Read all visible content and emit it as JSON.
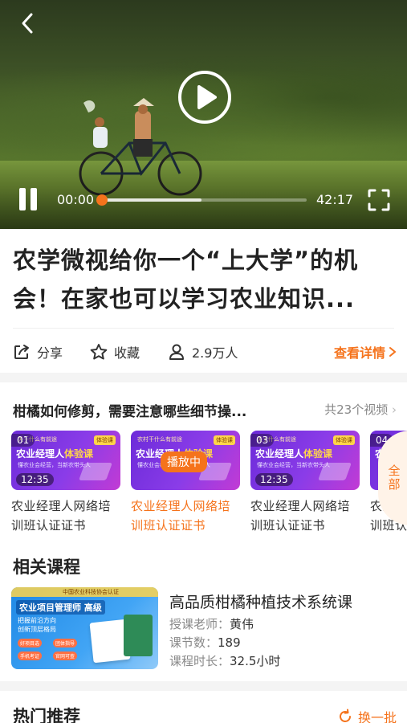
{
  "player": {
    "current_time": "00:00",
    "total_time": "42:17",
    "progress_fraction": 0.0,
    "buffered_fraction": 0.49
  },
  "video": {
    "title": "农学微视给你一个“上大学”的机会！在家也可以学习农业知识..."
  },
  "actions": {
    "share": "分享",
    "favorite": "收藏",
    "viewers": "2.9万人",
    "details": "查看详情"
  },
  "episodes": {
    "header_title": "柑橘如何修剪，需要注意哪些细节操...",
    "count": "共23个视频",
    "all_label": "全部",
    "playing_label": "播放中",
    "items": [
      {
        "num": "01",
        "duration": "12:35",
        "name": "农业经理人网络培训班认证证书",
        "active": false,
        "thumb_top": "关于什么有前途",
        "thumb_title_a": "农业经理人",
        "thumb_title_b": "体验课",
        "thumb_sub": "懂农业会经营，当新农带头人",
        "thumb_tag": "体验课"
      },
      {
        "num": "",
        "duration": "",
        "name": "农业经理人网络培训班认证证书",
        "active": true,
        "thumb_top": "农村干什么有前途",
        "thumb_title_a": "农业经理人",
        "thumb_title_b": "体验课",
        "thumb_sub": "懂农业会经营，当新农带头人",
        "thumb_tag": "体验课"
      },
      {
        "num": "03",
        "duration": "12:35",
        "name": "农业经理人网络培训班认证证书",
        "active": false,
        "thumb_top": "关于什么有前途",
        "thumb_title_a": "农业经理人",
        "thumb_title_b": "体验课",
        "thumb_sub": "懂农业会经营，当新农带头人",
        "thumb_tag": "体验课"
      },
      {
        "num": "04",
        "duration": "",
        "name": "农业经理人网络培训班认证证书",
        "active": false,
        "thumb_top": "",
        "thumb_title_a": "农",
        "thumb_title_b": "",
        "thumb_sub": "",
        "thumb_tag": ""
      }
    ]
  },
  "related": {
    "section_title": "相关课程",
    "course": {
      "name": "高品质柑橘种植技术系统课",
      "teacher_label": "授课老师：",
      "teacher": "黄伟",
      "lessons_label": "课节数：",
      "lessons": "189",
      "duration_label": "课程时长：",
      "duration": "32.5小时",
      "cover_title": "农业项目管理师 高级",
      "cover_ribbon": "中国农业科技协会认证",
      "cover_lines": "把握前沿方向\n创新顶层格局",
      "cover_chips": [
        "好项目选",
        "团体指导",
        "手机考证",
        "官网可查"
      ]
    }
  },
  "hot": {
    "section_title": "热门推荐",
    "refresh": "换一批"
  },
  "colors": {
    "accent": "#f5731c",
    "purple": "#7a34e0"
  }
}
